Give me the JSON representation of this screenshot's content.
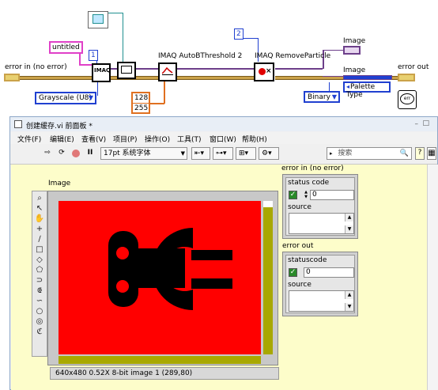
{
  "block_diagram": {
    "error_in_label": "error in (no error)",
    "error_out_label": "error out",
    "image_out_label_top": "Image",
    "image_out_label_bottom": "Image",
    "string_constant": "untitled",
    "int_constant_1": "1",
    "int_constant_2": "2",
    "grayscale_enum": "Grayscale (U8)",
    "binary_enum": "Binary",
    "palette_enum": "Palette Type",
    "range_low": "128",
    "range_high": "255",
    "autothreshold_label": "IMAQ AutoBThreshold 2",
    "removeparticle_label": "IMAQ RemoveParticle",
    "imaq_create_label": "IMAQ"
  },
  "front_panel": {
    "window_title": "创建缓存.vi 前面板 *",
    "menu": [
      "文件(F)",
      "编辑(E)",
      "查看(V)",
      "项目(P)",
      "操作(O)",
      "工具(T)",
      "窗口(W)",
      "帮助(H)"
    ],
    "font_dropdown": "17pt 系统字体",
    "search_placeholder": "搜索",
    "image_label": "Image",
    "image_status": "640x480 0.52X 8-bit image 1     (289,80)",
    "error_in": {
      "label": "error in (no error)",
      "status_header": "status code",
      "code_value": "0",
      "source_label": "source"
    },
    "error_out": {
      "label": "error out",
      "status_header": "statuscode",
      "code_value": "0",
      "source_label": "source"
    }
  },
  "colors": {
    "image_background": "#ff0000",
    "image_shape": "#000000",
    "panel_background": "#fdfdca",
    "error_wire": "#caa24a",
    "image_wire": "#6d3f8a",
    "string_wire": "#e040c8",
    "int_wire": "#2040d0",
    "u8_wire": "#e07020"
  }
}
